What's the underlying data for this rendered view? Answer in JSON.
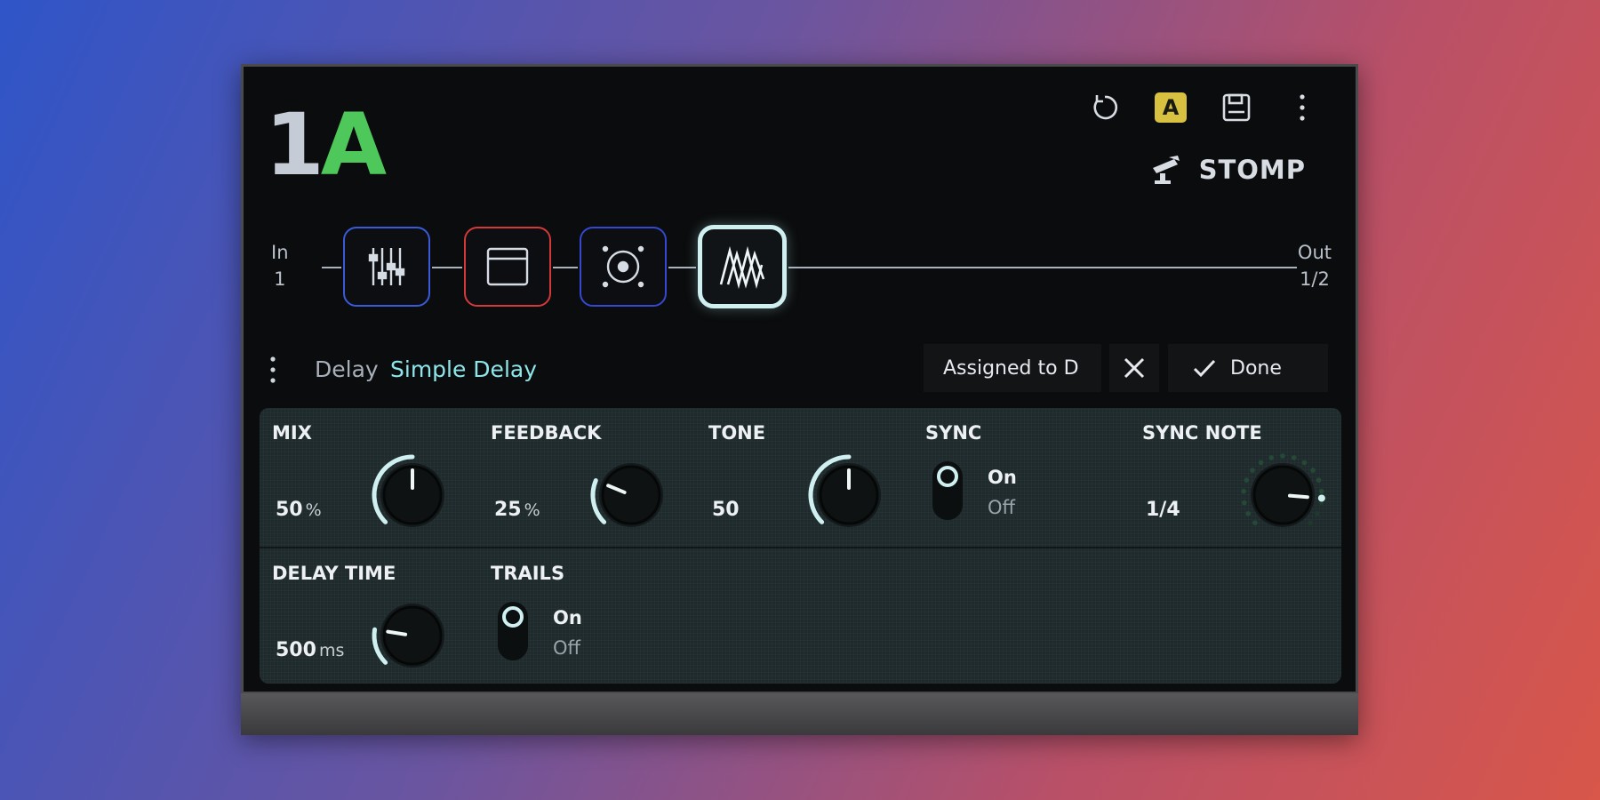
{
  "preset": {
    "number": "1",
    "bank": "A"
  },
  "top_icons": [
    "undo-icon",
    "snapshot-a-badge",
    "save-icon",
    "more-vertical-icon"
  ],
  "snapshot_badge": "A",
  "mode": {
    "label": "STOMP",
    "icon": "stomp-footswitch-icon"
  },
  "signal_chain": {
    "input": {
      "label": "In",
      "value": "1"
    },
    "output": {
      "label": "Out",
      "value": "1/2"
    },
    "blocks": [
      {
        "id": "eq",
        "icon": "eq-sliders-icon",
        "color": "#3b5ad8"
      },
      {
        "id": "amp",
        "icon": "amp-icon",
        "color": "#d23a3a"
      },
      {
        "id": "cab",
        "icon": "speaker-cab-icon",
        "color": "#3548d0"
      },
      {
        "id": "delay",
        "icon": "delay-wave-icon",
        "color": "#cfeff0",
        "selected": true
      }
    ]
  },
  "block_header": {
    "category": "Delay",
    "model": "Simple Delay",
    "assigned": "Assigned to D",
    "done_label": "Done"
  },
  "params": {
    "mix": {
      "name": "MIX",
      "value": "50",
      "unit": "%",
      "level": 0.5
    },
    "feedback": {
      "name": "FEEDBACK",
      "value": "25",
      "unit": "%",
      "level": 0.25
    },
    "tone": {
      "name": "TONE",
      "value": "50",
      "level": 0.5
    },
    "sync": {
      "name": "SYNC",
      "on_label": "On",
      "off_label": "Off",
      "state": "On"
    },
    "sync_note": {
      "name": "SYNC NOTE",
      "value": "1/4",
      "level": 0.85
    },
    "delay_time": {
      "name": "DELAY TIME",
      "value": "500",
      "unit": "ms",
      "level": 0.2
    },
    "trails": {
      "name": "TRAILS",
      "on_label": "On",
      "off_label": "Off",
      "state": "On"
    }
  },
  "colors": {
    "accent": "#8fe6ea",
    "knob_arc": "#cfeff0",
    "bank": "#4ec85a",
    "badge": "#d8c040"
  }
}
